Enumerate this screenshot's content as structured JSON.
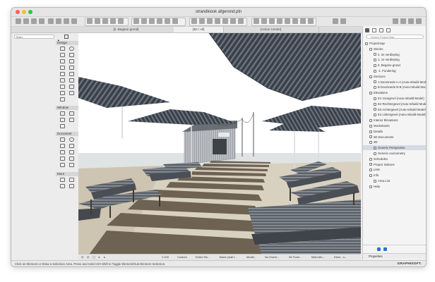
{
  "window": {
    "title": "strandkiosk afgerond.pln"
  },
  "colors": {
    "close": "#ff5f57",
    "minimize": "#febc2e",
    "zoom": "#28c840",
    "accent": "#2f6fd6",
    "selection": "#d5dbe3",
    "umbrella_dark": "#3a4049",
    "umbrella_stripe": "#6c747e",
    "deck": "#6e6252",
    "sand": "#d9d1c0"
  },
  "tabs": [
    {
      "label": "[0. Begane grond]"
    },
    {
      "label": "[3D / All]"
    },
    {
      "label": "[Action Center]"
    }
  ],
  "toolbox": {
    "search_placeholder": "Main:",
    "sections": [
      {
        "label": "Design"
      },
      {
        "label": "Window"
      },
      {
        "label": "Document"
      },
      {
        "label": "More"
      }
    ]
  },
  "navigator": {
    "search_placeholder": "Search Project Map",
    "items": [
      {
        "label": "Projectmap",
        "level": 0
      },
      {
        "label": "Stories",
        "level": 1
      },
      {
        "label": "2. 2e verdieping",
        "level": 2
      },
      {
        "label": "1. 1e verdieping",
        "level": 2
      },
      {
        "label": "0. Begane grond",
        "level": 2
      },
      {
        "label": "-1. Fundering",
        "level": 2
      },
      {
        "label": "Sections",
        "level": 1
      },
      {
        "label": "A Doorsnede A-A (Auto-rebuild Model)",
        "level": 2
      },
      {
        "label": "B Doorsnede B-B (Auto-rebuild Model)",
        "level": 2
      },
      {
        "label": "Elevations",
        "level": 1
      },
      {
        "label": "E1 Voorgevel (Auto-rebuild Model)",
        "level": 2
      },
      {
        "label": "E2 Rechtergevel (Auto-rebuild Model)",
        "level": 2
      },
      {
        "label": "E3 Achtergevel (Auto-rebuild Model)",
        "level": 2
      },
      {
        "label": "E4 Linkergevel (Auto-rebuild Model)",
        "level": 2
      },
      {
        "label": "Interior Elevations",
        "level": 1
      },
      {
        "label": "Worksheets",
        "level": 1
      },
      {
        "label": "Details",
        "level": 1
      },
      {
        "label": "3D Documents",
        "level": 1
      },
      {
        "label": "3D",
        "level": 1
      },
      {
        "label": "Generic Perspective",
        "level": 2,
        "selected": true
      },
      {
        "label": "Generic Axonometry",
        "level": 2
      },
      {
        "label": "Schedules",
        "level": 1
      },
      {
        "label": "Project Indexes",
        "level": 1
      },
      {
        "label": "Lists",
        "level": 1
      },
      {
        "label": "Info",
        "level": 1
      },
      {
        "label": "Area List",
        "level": 2
      },
      {
        "label": "Help",
        "level": 1
      }
    ],
    "properties_label": "Properties"
  },
  "quick_options": [
    {
      "label": "1:100"
    },
    {
      "label": "Custom"
    },
    {
      "label": "Entire Mo..."
    },
    {
      "label": "Basic (wall f..."
    },
    {
      "label": "Model..."
    },
    {
      "label": "No Overri..."
    },
    {
      "label": "06 Tooni..."
    },
    {
      "label": "Main-Mo..."
    },
    {
      "label": "Klare - s..."
    }
  ],
  "status": {
    "text": "Click an Element or Draw a Selection Area. Press and Hold Ctrl+Shift to Toggle Element/Sub-Element Selection."
  },
  "brand": "GRAPHISOFT."
}
